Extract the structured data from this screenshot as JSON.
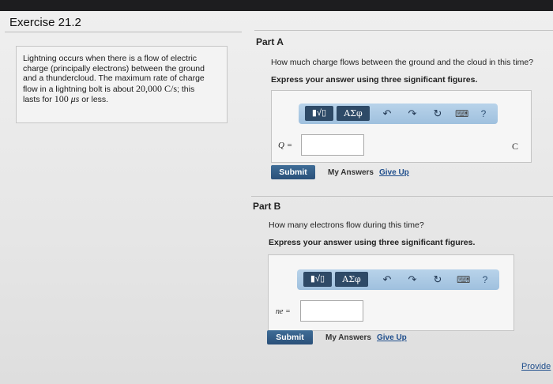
{
  "exercise": {
    "title": "Exercise 21.2",
    "problem": {
      "l1": "Lightning occurs when there is a flow of electric",
      "l2": "charge (principally electrons) between the ground",
      "l3": "and a thundercloud. The maximum rate of charge",
      "l4_pre": "flow in a lightning bolt is about ",
      "l4_num": "20,000 C/s",
      "l4_post": "; this",
      "l5_pre": "lasts for ",
      "l5_num": "100",
      "l5_unit": "μs",
      "l5_post": " or less."
    }
  },
  "toolbar": {
    "template_label": "▮√▯",
    "greek_label": "ΑΣφ",
    "undo_icon": "↶",
    "redo_icon": "↷",
    "reset_icon": "↻",
    "keyboard_icon": "⌨",
    "help_label": "?"
  },
  "part_a": {
    "title": "Part A",
    "question": "How much charge flows between the ground and the cloud in this time?",
    "instruction": "Express your answer using three significant figures.",
    "variable_label": "Q =",
    "unit": "C",
    "input_value": "",
    "submit": "Submit",
    "my_answers": "My Answers",
    "give_up": "Give Up"
  },
  "part_b": {
    "title": "Part B",
    "question": "How many electrons flow during this time?",
    "instruction": "Express your answer using three significant figures.",
    "variable_label": "ne =",
    "input_value": "",
    "submit": "Submit",
    "my_answers": "My Answers",
    "give_up": "Give Up"
  },
  "footer": {
    "provide_feedback": "Provide"
  }
}
